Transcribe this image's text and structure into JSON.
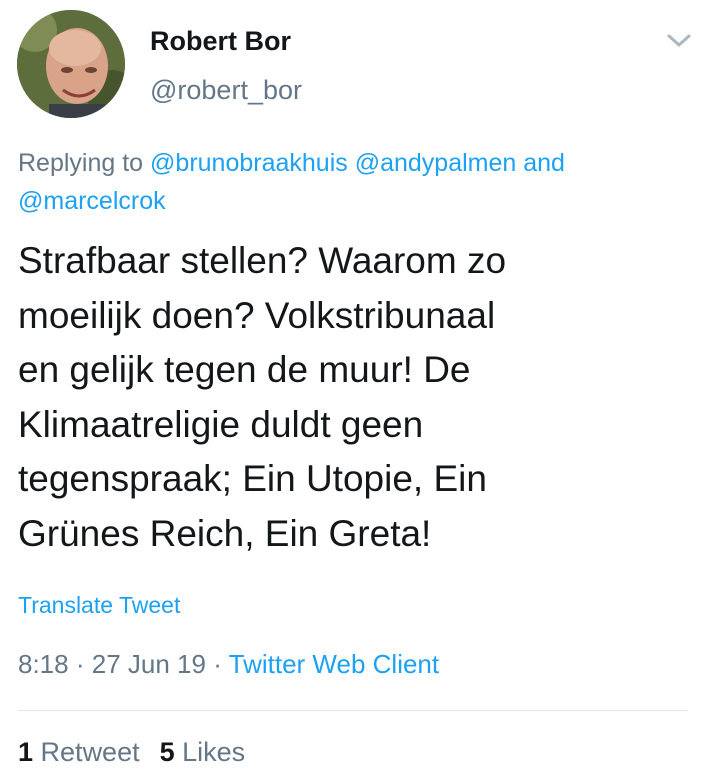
{
  "author": {
    "display_name": "Robert Bor",
    "handle": "@robert_bor",
    "avatar_icon": "profile-photo"
  },
  "menu_icon": "chevron-down-icon",
  "reply_context": {
    "prefix": "Replying to",
    "mentions": [
      "@brunobraakhuis",
      "@andypalmen",
      "@marcelcrok"
    ],
    "conjunction": "and"
  },
  "tweet": {
    "lines": [
      "Strafbaar stellen? Waarom zo",
      "moeilijk doen? Volkstribunaal",
      "en gelijk tegen de muur! De",
      "Klimaatreligie duldt geen",
      "tegenspraak; Ein Utopie, Ein",
      "Grünes Reich, Ein Greta!"
    ]
  },
  "translate_label": "Translate Tweet",
  "meta": {
    "time": "8:18",
    "separator": "·",
    "date": "27 Jun 19",
    "client": "Twitter Web Client"
  },
  "stats": {
    "retweets_count": "1",
    "retweets_label": "Retweet",
    "likes_count": "5",
    "likes_label": "Likes"
  },
  "colors": {
    "link": "#1da1f2",
    "secondary_text": "#657786",
    "primary_text": "#14171a",
    "divider": "#e1e8ed"
  }
}
